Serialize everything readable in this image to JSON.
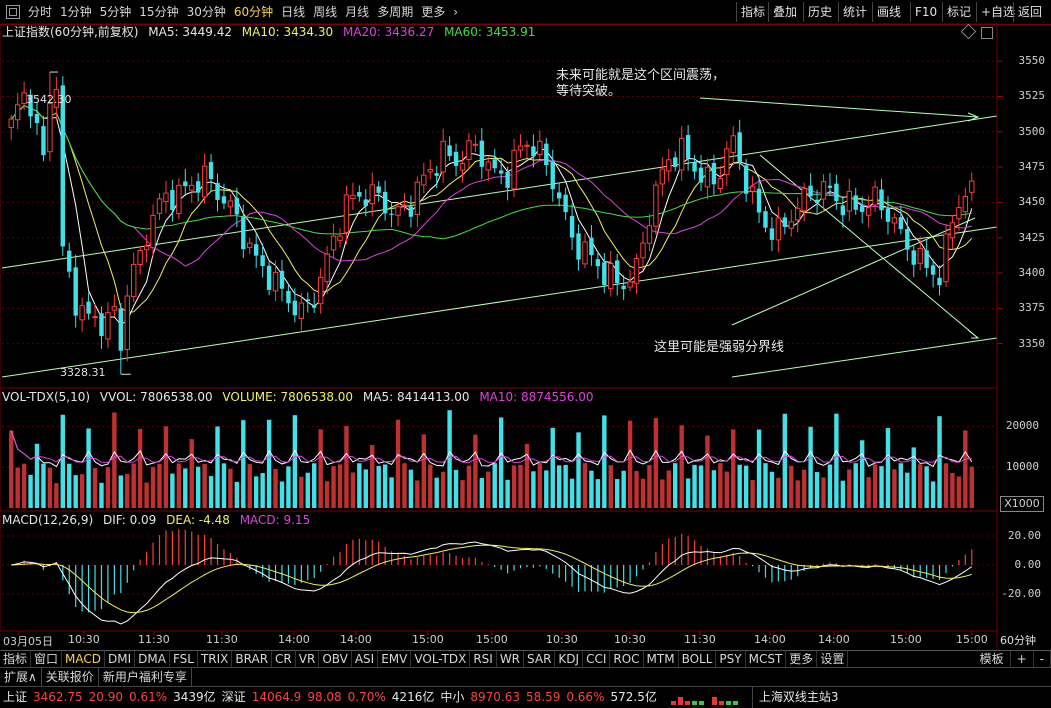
{
  "toolbar": {
    "periods": [
      "分时",
      "1分钟",
      "5分钟",
      "15分钟",
      "30分钟",
      "60分钟",
      "日线",
      "周线",
      "月线",
      "多周期",
      "更多"
    ],
    "active_period": "60分钟",
    "right_buttons": [
      "指标",
      "叠加",
      "历史",
      "统计",
      "画线",
      "F10",
      "标记",
      "+自选",
      "返回"
    ]
  },
  "main": {
    "title": "上证指数(60分钟,前复权)",
    "ma5": "MA5: 3449.42",
    "ma10": "MA10: 3434.30",
    "ma20": "MA20: 3436.27",
    "ma60": "MA60: 3453.91",
    "high_label": "3542.30",
    "low_label": "3328.31",
    "annotation_top": [
      "未来可能就是这个区间震荡，",
      "等待突破。"
    ],
    "annotation_bottom": "这里可能是强弱分界线",
    "colors": {
      "up": "#ff3b3b",
      "down": "#40e0e8",
      "ma5": "#ffffff",
      "ma10": "#f0f060",
      "ma20": "#e040e0",
      "ma60": "#40e040",
      "trend": "#b8ffb8"
    }
  },
  "volume": {
    "title": "VOL-TDX(5,10)",
    "vvol": "VVOL: 7806538.00",
    "volume": "VOLUME: 7806538.00",
    "ma5": "MA5: 8414413.00",
    "ma10": "MA10: 8874556.00",
    "unit": "X1000"
  },
  "macd": {
    "title": "MACD(12,26,9)",
    "dif": "DIF: 0.09",
    "dea": "DEA: -4.48",
    "macd": "MACD: 9.15"
  },
  "chart_data": {
    "type": "candlestick",
    "title": "上证指数(60分钟,前复权)",
    "y_axis": {
      "ticks": [
        3550,
        3525,
        3500,
        3475,
        3450,
        3425,
        3400,
        3375,
        3350
      ],
      "range": [
        3320,
        3565
      ]
    },
    "volume_axis": {
      "ticks": [
        20000,
        10000
      ],
      "unit": "X1000"
    },
    "macd_axis": {
      "ticks": [
        "20.00",
        "0.00",
        "-20.00"
      ]
    },
    "x_labels": [
      "03月05日",
      "10:30",
      "11:30",
      "11:30",
      "14:00",
      "14:00",
      "15:00",
      "15:00",
      "10:30",
      "10:30",
      "11:30",
      "14:00",
      "14:00",
      "15:00",
      "15:00"
    ],
    "period_label": "60分钟",
    "close": [
      3505,
      3525,
      3480,
      3430,
      3380,
      3360,
      3365,
      3390,
      3410,
      3440,
      3455,
      3465,
      3470,
      3450,
      3440,
      3420,
      3400,
      3380,
      3370,
      3390,
      3420,
      3445,
      3455,
      3460,
      3440,
      3445,
      3470,
      3490,
      3480,
      3485,
      3470,
      3475,
      3495,
      3480,
      3460,
      3430,
      3415,
      3395,
      3390,
      3405,
      3450,
      3475,
      3485,
      3475,
      3465,
      3490,
      3460,
      3440,
      3430,
      3440,
      3455,
      3465,
      3450,
      3440,
      3450,
      3445,
      3420,
      3400,
      3395,
      3455,
      3460
    ]
  }
}
